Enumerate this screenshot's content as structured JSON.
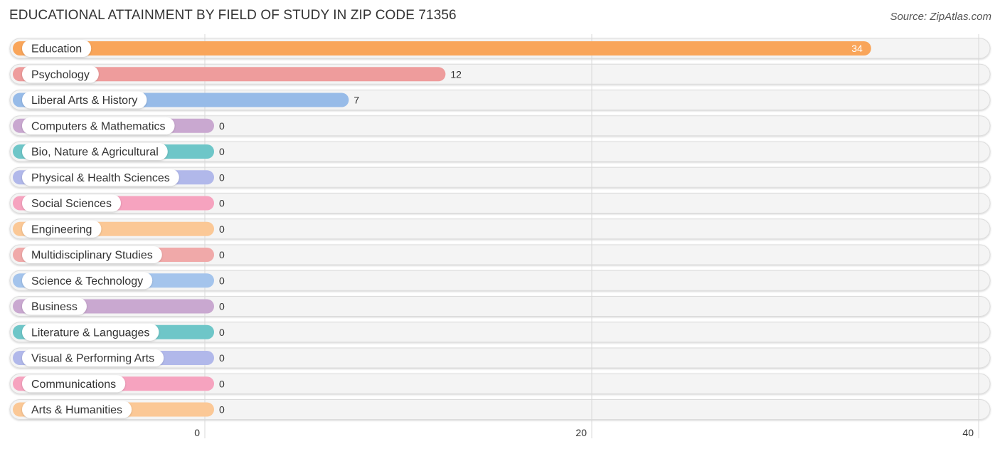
{
  "header": {
    "title": "EDUCATIONAL ATTAINMENT BY FIELD OF STUDY IN ZIP CODE 71356",
    "source": "Source: ZipAtlas.com"
  },
  "chart_data": {
    "type": "bar",
    "orientation": "horizontal",
    "title": "EDUCATIONAL ATTAINMENT BY FIELD OF STUDY IN ZIP CODE 71356",
    "xlabel": "",
    "ylabel": "",
    "xlim": [
      0,
      40
    ],
    "xticks": [
      0,
      20,
      40
    ],
    "tick_labels": [
      "0",
      "20",
      "40"
    ],
    "grid": true,
    "categories": [
      "Education",
      "Psychology",
      "Liberal Arts & History",
      "Computers & Mathematics",
      "Bio, Nature & Agricultural",
      "Physical & Health Sciences",
      "Social Sciences",
      "Engineering",
      "Multidisciplinary Studies",
      "Science & Technology",
      "Business",
      "Literature & Languages",
      "Visual & Performing Arts",
      "Communications",
      "Arts & Humanities"
    ],
    "values": [
      34,
      12,
      7,
      0,
      0,
      0,
      0,
      0,
      0,
      0,
      0,
      0,
      0,
      0,
      0
    ],
    "value_labels": [
      "34",
      "12",
      "7",
      "0",
      "0",
      "0",
      "0",
      "0",
      "0",
      "0",
      "0",
      "0",
      "0",
      "0",
      "0"
    ],
    "colors": [
      "#f9a55a",
      "#ee9c9c",
      "#97bbe8",
      "#c9a8d0",
      "#6ec6c8",
      "#b1b8ea",
      "#f6a3bf",
      "#fbc896",
      "#f0a9a9",
      "#a4c4ec",
      "#c9a8d0",
      "#6ec6c8",
      "#b1b8ea",
      "#f6a3bf",
      "#fbc896"
    ]
  }
}
